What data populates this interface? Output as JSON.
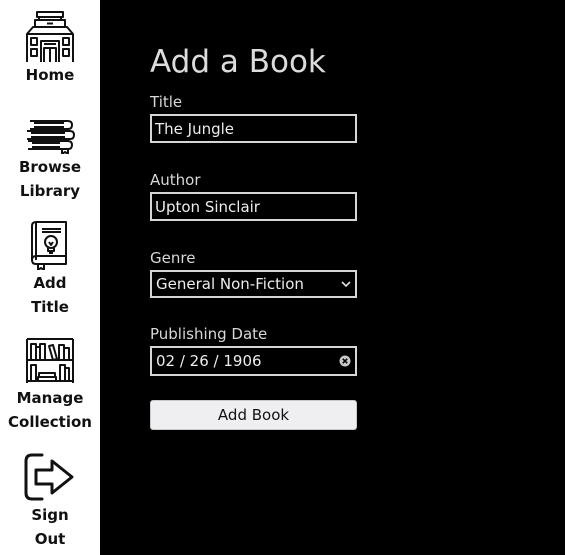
{
  "sidebar": {
    "items": [
      {
        "id": "home",
        "icon": "library-building-icon",
        "label_lines": [
          "Home"
        ]
      },
      {
        "id": "browse-library",
        "icon": "book-stack-icon",
        "label_lines": [
          "Browse",
          "Library"
        ]
      },
      {
        "id": "add-title",
        "icon": "lightbulb-book-icon",
        "label_lines": [
          "Add",
          "Title"
        ]
      },
      {
        "id": "manage-collection",
        "icon": "bookshelf-icon",
        "label_lines": [
          "Manage",
          "Collection"
        ]
      },
      {
        "id": "sign-out",
        "icon": "sign-out-icon",
        "label_lines": [
          "Sign",
          "Out"
        ]
      }
    ]
  },
  "main": {
    "title": "Add a Book",
    "form": {
      "title_field": {
        "label": "Title",
        "value": "The Jungle"
      },
      "author_field": {
        "label": "Author",
        "value": "Upton Sinclair"
      },
      "genre_field": {
        "label": "Genre",
        "value": "General Non-Fiction"
      },
      "date_field": {
        "label": "Publishing Date",
        "value": "02 / 26 / 1906",
        "clear_icon": "clear-circle-icon"
      },
      "submit_label": "Add Book"
    }
  },
  "colors": {
    "sidebar_background": "#ffffff",
    "main_background": "#000000",
    "text_light": "#dcdcdc",
    "field_border": "#d6d6d6",
    "button_background": "#efeff1"
  }
}
